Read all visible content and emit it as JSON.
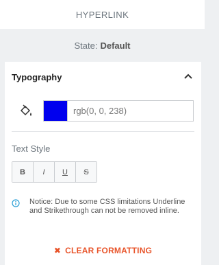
{
  "header": {
    "title": "HYPERLINK"
  },
  "state": {
    "label": "State:",
    "value": "Default"
  },
  "typography": {
    "title": "Typography",
    "color": {
      "hex": "#0000ee",
      "value": "rgb(0, 0, 238)"
    },
    "text_style_label": "Text Style",
    "buttons": [
      "B",
      "I",
      "U",
      "S"
    ],
    "notice": "Notice: Due to some CSS limitations Underline and Strikethrough can not be removed inline.",
    "clear_label": "CLEAR FORMATTING"
  },
  "colors": {
    "accent": "#e8542a",
    "info": "#2a9fd6"
  },
  "icons": [
    "chevron-up-icon",
    "paint-bucket-icon",
    "info-icon",
    "close-icon"
  ]
}
